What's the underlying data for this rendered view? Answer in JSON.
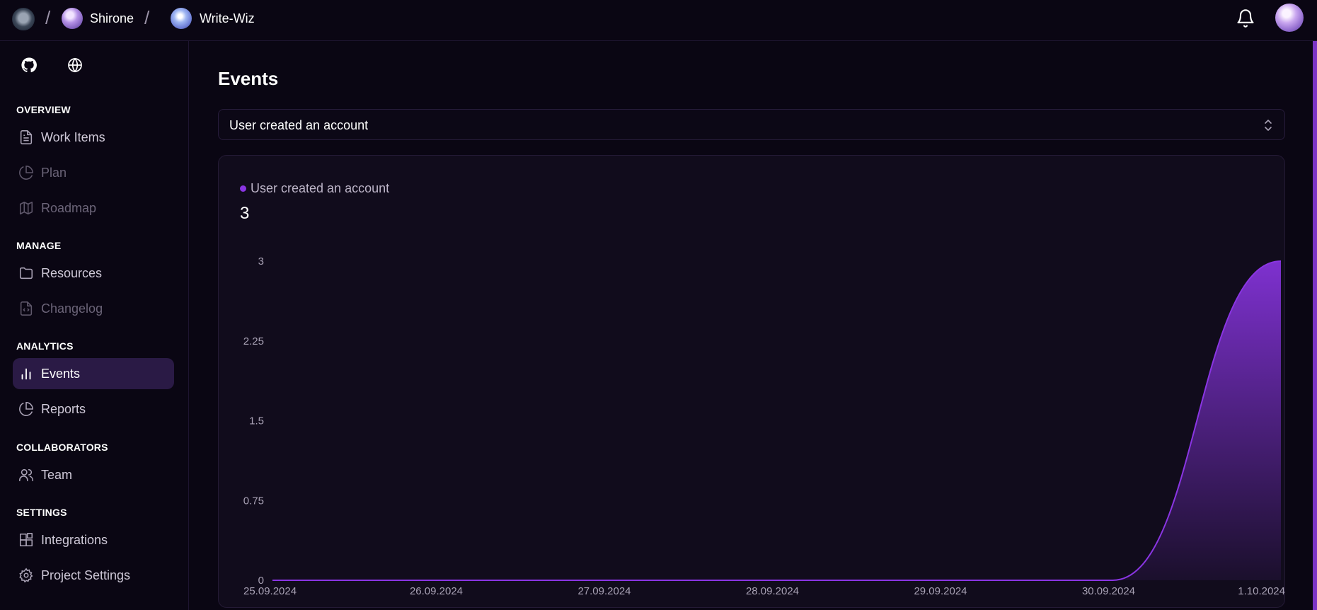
{
  "breadcrumb": {
    "org_name": "Shirone",
    "project_name": "Write-Wiz",
    "separator": "/"
  },
  "icons": {
    "logo": "app-logo-icon",
    "bell": "bell-icon",
    "github": "github-icon",
    "globe": "globe-icon"
  },
  "sidebar": {
    "sections": [
      {
        "title": "OVERVIEW",
        "items": [
          {
            "label": "Work Items",
            "icon": "document-icon",
            "disabled": false
          },
          {
            "label": "Plan",
            "icon": "pie-chart-icon",
            "disabled": true
          },
          {
            "label": "Roadmap",
            "icon": "map-icon",
            "disabled": true
          }
        ]
      },
      {
        "title": "MANAGE",
        "items": [
          {
            "label": "Resources",
            "icon": "folder-icon",
            "disabled": false
          },
          {
            "label": "Changelog",
            "icon": "file-code-icon",
            "disabled": true
          }
        ]
      },
      {
        "title": "ANALYTICS",
        "items": [
          {
            "label": "Events",
            "icon": "bar-chart-icon",
            "active": true
          },
          {
            "label": "Reports",
            "icon": "pie-chart-icon",
            "disabled": false
          }
        ]
      },
      {
        "title": "COLLABORATORS",
        "items": [
          {
            "label": "Team",
            "icon": "users-icon",
            "disabled": false
          }
        ]
      },
      {
        "title": "SETTINGS",
        "items": [
          {
            "label": "Integrations",
            "icon": "blocks-icon",
            "disabled": false
          },
          {
            "label": "Project Settings",
            "icon": "gear-icon",
            "disabled": false
          }
        ]
      }
    ]
  },
  "main": {
    "title": "Events",
    "event_select": {
      "value": "User created an account",
      "icon": "chevrons-up-down-icon"
    },
    "summary": {
      "legend_label": "User created an account",
      "total": "3"
    }
  },
  "colors": {
    "background": "#0a0613",
    "accent": "#8a35e3",
    "active_nav": "#2a1a45"
  },
  "chart_data": {
    "type": "area",
    "x": [
      "25.09.2024",
      "26.09.2024",
      "27.09.2024",
      "28.09.2024",
      "29.09.2024",
      "30.09.2024",
      "1.10.2024"
    ],
    "series": [
      {
        "name": "User created an account",
        "values": [
          0,
          0,
          0,
          0,
          0,
          0,
          3
        ],
        "color": "#8a35e3"
      }
    ],
    "y_ticks": [
      "0",
      "0.75",
      "1.5",
      "2.25",
      "3"
    ],
    "ylim": [
      0,
      3
    ],
    "grid": false,
    "legend": "top-left"
  }
}
